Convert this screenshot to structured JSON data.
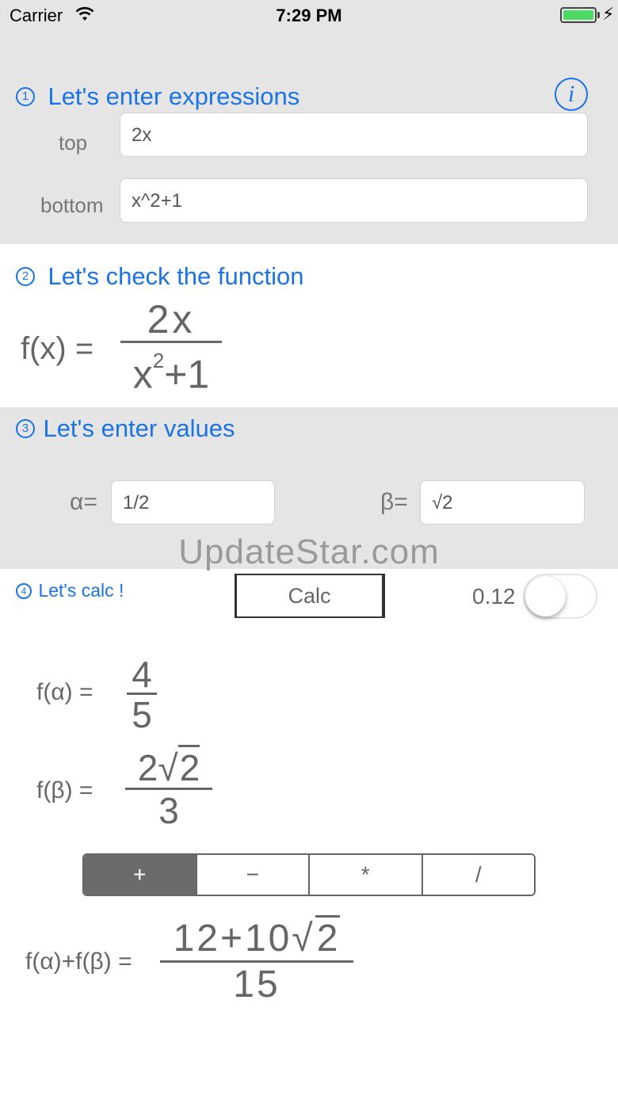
{
  "status_bar": {
    "carrier": "Carrier",
    "time": "7:29 PM"
  },
  "section1": {
    "number": "1",
    "heading": "Let's enter expressions",
    "info_icon": "i",
    "top_label": "top",
    "top_value": "2x",
    "bottom_label": "bottom",
    "bottom_value": "x^2+1"
  },
  "section2": {
    "number": "2",
    "heading": "Let's check the function",
    "lhs": "f(x) =",
    "numerator": "2x",
    "den_base": "x",
    "den_exp": "2",
    "den_rest": "+1"
  },
  "section3": {
    "number": "3",
    "heading": "Let's enter values",
    "alpha_label": "α=",
    "alpha_value": "1/2",
    "beta_label": "β=",
    "beta_value": "√2"
  },
  "watermark": "UpdateStar.com",
  "section4": {
    "number": "4",
    "heading": "Let's calc !",
    "calc_label": "Calc",
    "toggle_value": "0.12",
    "toggle_on": false,
    "f_alpha_label": "f(α) =",
    "f_alpha_num": "4",
    "f_alpha_den": "5",
    "f_beta_label": "f(β) =",
    "f_beta_num_coef": "2",
    "f_beta_num_rad": "2",
    "f_beta_den": "3",
    "ops": [
      "+",
      "−",
      "*",
      "/"
    ],
    "selected_op": "+",
    "result_label": "f(α)+f(β) =",
    "result_num_left": "12+10",
    "result_num_rad": "2",
    "result_den": "15"
  }
}
